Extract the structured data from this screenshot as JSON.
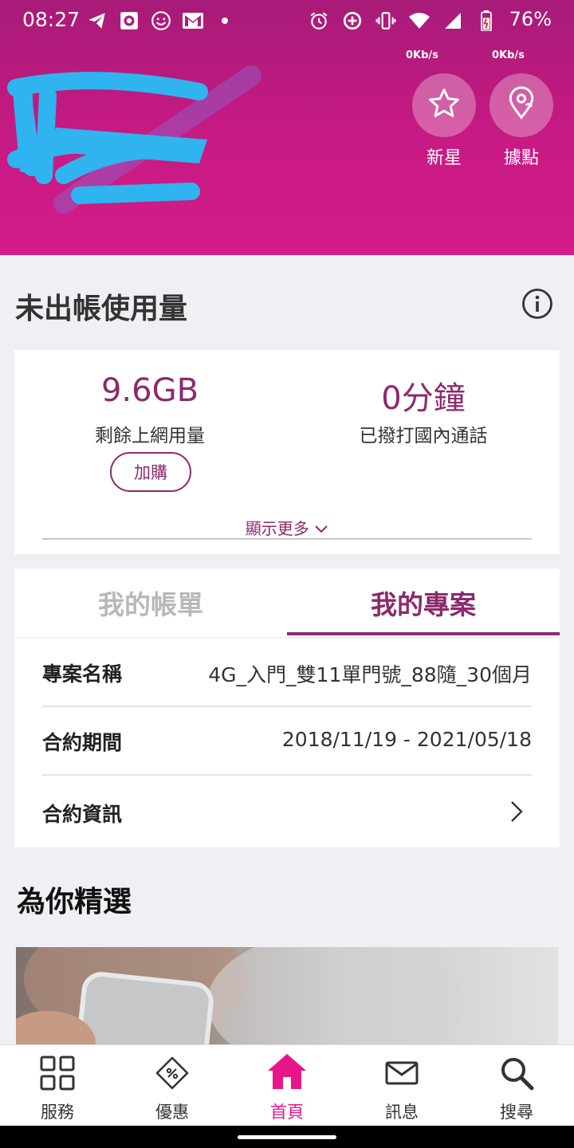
{
  "status_bar": {
    "time": "08:27",
    "battery_percent": "76%",
    "left_icons": [
      "telegram-icon",
      "camera-icon",
      "smiley-icon",
      "gmail-icon",
      "dot-icon"
    ],
    "right_icons": [
      "alarm-icon",
      "data-saver-icon",
      "vibrate-icon",
      "wifi-icon",
      "signal-icon",
      "battery-icon"
    ]
  },
  "header": {
    "net_speed_1": "0Kb/s",
    "net_speed_2": "0Kb/s",
    "star_button_label": "新星",
    "location_button_label": "據點",
    "background_color": "#c81a84"
  },
  "usage": {
    "title": "未出帳使用量",
    "data_value": "9.6GB",
    "data_caption": "剩餘上網用量",
    "buy_label": "加購",
    "call_value": "0分鐘",
    "call_caption": "已撥打國內通話",
    "show_more_label": "顯示更多"
  },
  "tabs": [
    {
      "label": "我的帳單",
      "active": false
    },
    {
      "label": "我的專案",
      "active": true
    }
  ],
  "plan": {
    "rows": [
      {
        "label": "專案名稱",
        "value": "4G_入門_雙11單門號_88隨_30個月"
      },
      {
        "label": "合約期間",
        "value": "2018/11/19 - 2021/05/18"
      },
      {
        "label": "合約資訊",
        "value": ""
      }
    ]
  },
  "for_you": {
    "title": "為你精選"
  },
  "bottom_nav": [
    {
      "label": "服務",
      "icon": "grid-icon",
      "active": false
    },
    {
      "label": "優惠",
      "icon": "coupon-icon",
      "active": false
    },
    {
      "label": "首頁",
      "icon": "home-icon",
      "active": true
    },
    {
      "label": "訊息",
      "icon": "mail-icon",
      "active": false
    },
    {
      "label": "搜尋",
      "icon": "search-icon",
      "active": false
    }
  ],
  "colors": {
    "accent": "#8b2a6d",
    "brand_pink": "#e6168a",
    "inactive_tab": "#b8b8b8"
  }
}
